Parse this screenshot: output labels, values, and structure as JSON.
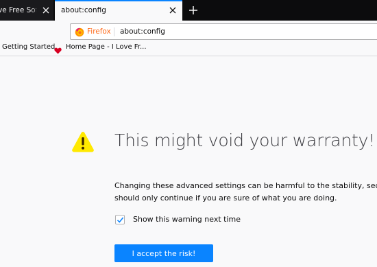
{
  "tabs": [
    {
      "title": "ve Free Softw",
      "active": false
    },
    {
      "title": "about:config",
      "active": true
    }
  ],
  "urlbar": {
    "identity_label": "Firefox",
    "url": "about:config"
  },
  "bookmarks": [
    {
      "label": "Getting Started",
      "icon": "none"
    },
    {
      "label": "Home Page - I Love Fr...",
      "icon": "heart-icon"
    }
  ],
  "warning": {
    "title": "This might void your warranty!",
    "line1": "Changing these advanced settings can be harmful to the stability, secu",
    "line2": "should only continue if you are sure of what you are doing.",
    "checkbox_label": "Show this warning next time",
    "checkbox_checked": true,
    "accept_label": "I accept the risk!"
  },
  "colors": {
    "accent": "#0a84ff",
    "warning_icon": "#ffe900",
    "heart": "#d70022",
    "firefox_label": "#ff6a1a"
  }
}
